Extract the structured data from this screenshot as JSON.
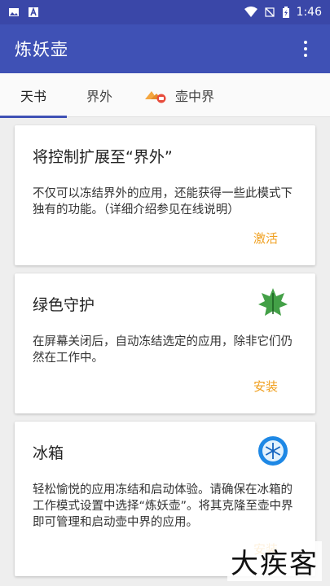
{
  "statusbar": {
    "time": "1:46",
    "left_icons": [
      "image-icon",
      "text-a-icon"
    ],
    "right_icons": [
      "wifi-icon",
      "no-signal-icon",
      "battery-icon"
    ]
  },
  "appbar": {
    "title": "炼妖壶",
    "menu_icon": "more-vert-icon"
  },
  "tabs": [
    {
      "label": "天书",
      "active": true
    },
    {
      "label": "界外",
      "active": false
    },
    {
      "label": "壶中界",
      "active": false,
      "icon": "island-icon"
    }
  ],
  "cards": [
    {
      "title": "将控制扩展至“界外”",
      "body": "不仅可以冻结界外的应用，还能获得一些此模式下独有的功能。（详细介绍参见在线说明）",
      "action": "激活"
    },
    {
      "title": "绿色守护",
      "body": "在屏幕关闭后，自动冻结选定的应用，除非它们仍然在工作中。",
      "action": "安装",
      "icon": "greenify-leaf-icon"
    },
    {
      "title": "冰箱",
      "body": "轻松愉悦的应用冻结和启动体验。请确保在冰箱的工作模式设置中选择“炼妖壶”。将其克隆至壶中界即可管理和启动壶中界的应用。",
      "action": "安装",
      "icon": "ice-box-snowflake-icon"
    }
  ],
  "watermark": "大疾客",
  "colors": {
    "primary": "#3f51b5",
    "statusbar": "#3a47a8",
    "accent": "#f0a020"
  }
}
